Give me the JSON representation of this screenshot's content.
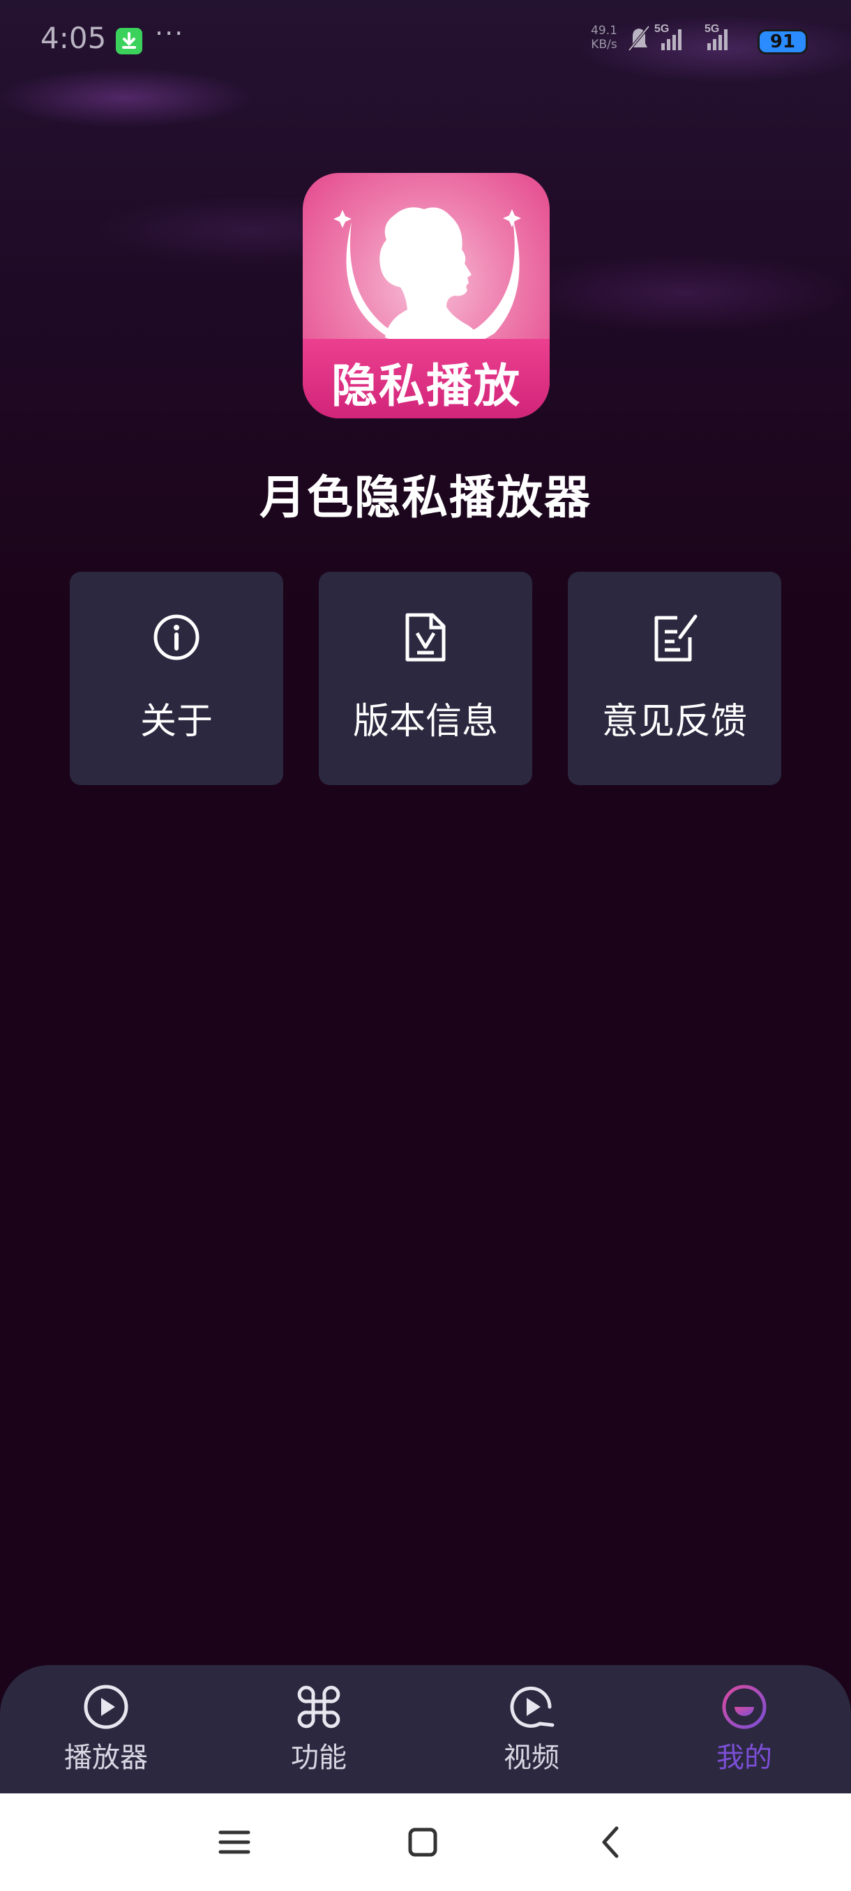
{
  "status_bar": {
    "time": "4:05",
    "more": "···",
    "net_speed_value": "49.1",
    "net_speed_unit": "KB/s",
    "signal_1_label": "5G",
    "signal_2_label": "5G",
    "battery": "91"
  },
  "app": {
    "icon_text": "隐私播放",
    "title": "月色隐私播放器"
  },
  "cards": [
    {
      "label": "关于",
      "icon": "info-icon"
    },
    {
      "label": "版本信息",
      "icon": "version-document-icon"
    },
    {
      "label": "意见反馈",
      "icon": "feedback-edit-icon"
    }
  ],
  "bottom_nav": {
    "items": [
      {
        "label": "播放器",
        "icon": "play-circle-icon",
        "active": false
      },
      {
        "label": "功能",
        "icon": "command-icon",
        "active": false
      },
      {
        "label": "视频",
        "icon": "video-play-icon",
        "active": false
      },
      {
        "label": "我的",
        "icon": "smile-profile-icon",
        "active": true
      }
    ],
    "active_color": "#7b4fd6"
  },
  "system_nav": {
    "buttons": [
      "menu-icon",
      "home-icon",
      "back-icon"
    ]
  },
  "colors": {
    "background": "#1c0519",
    "card": "#2b283f",
    "accent_pink": "#e23d86"
  }
}
